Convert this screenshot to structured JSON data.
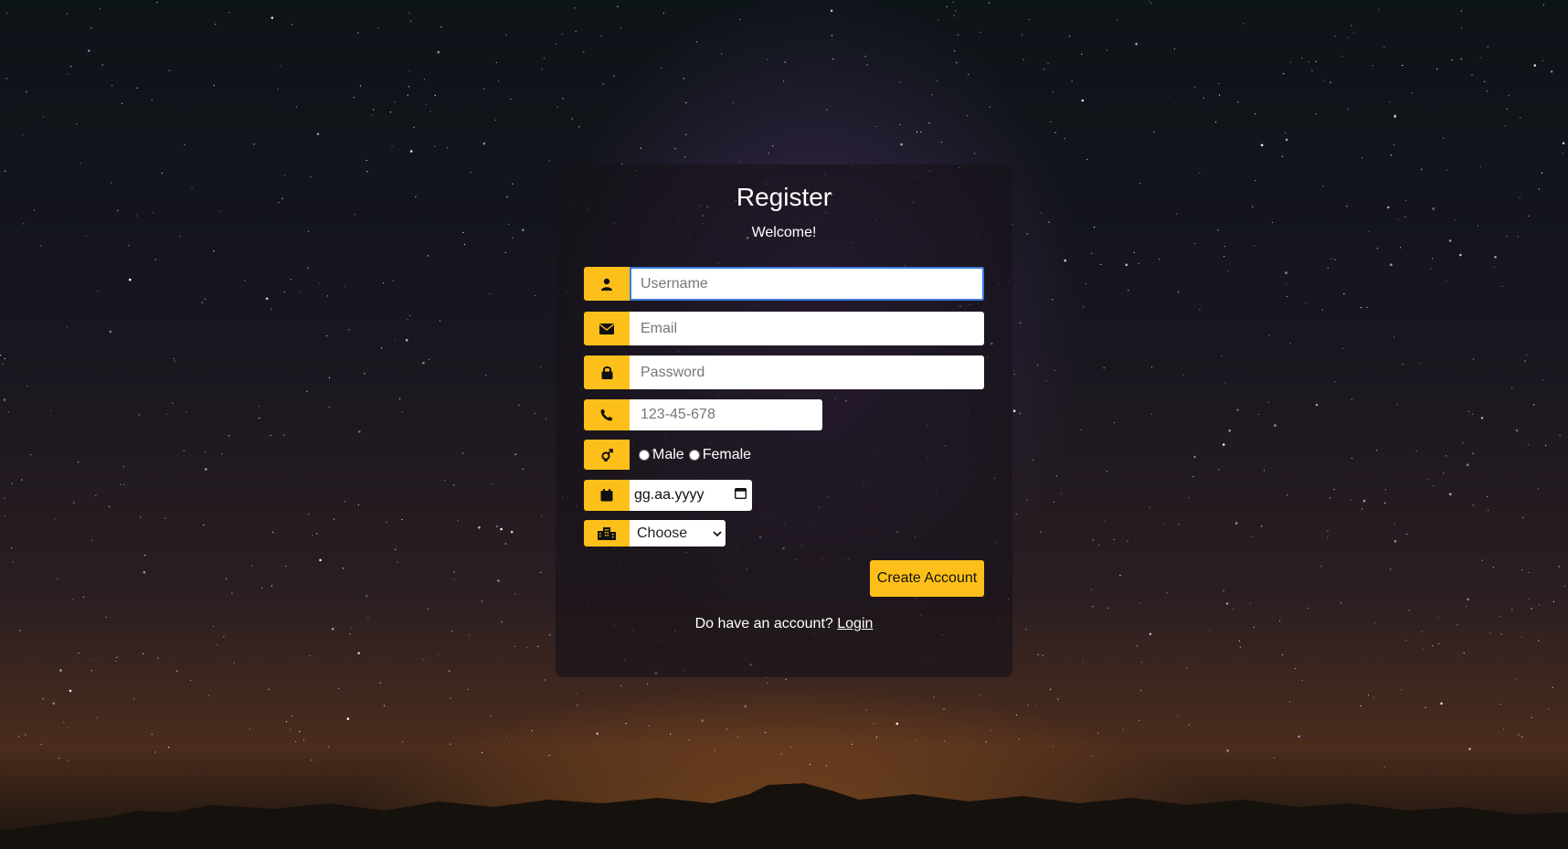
{
  "form": {
    "title": "Register",
    "subtitle": "Welcome!",
    "username_placeholder": "Username",
    "email_placeholder": "Email",
    "password_placeholder": "Password",
    "phone_placeholder": "123-45-678",
    "gender_options": [
      "Male",
      "Female"
    ],
    "date_placeholder": "gg.aa.yyyy",
    "city_selected": "Choose",
    "submit_label": "Create Account",
    "login_prompt": "Do have an account?",
    "login_link": "Login"
  },
  "colors": {
    "accent": "#fdc01a",
    "focus_border": "#3a79d8",
    "card_background": "rgba(22,18,24,0.62)"
  },
  "icons": [
    "user-icon",
    "envelope-icon",
    "lock-icon",
    "phone-icon",
    "gender-icon",
    "calendar-icon",
    "city-icon",
    "calendar-picker-icon",
    "chevron-down-icon"
  ]
}
